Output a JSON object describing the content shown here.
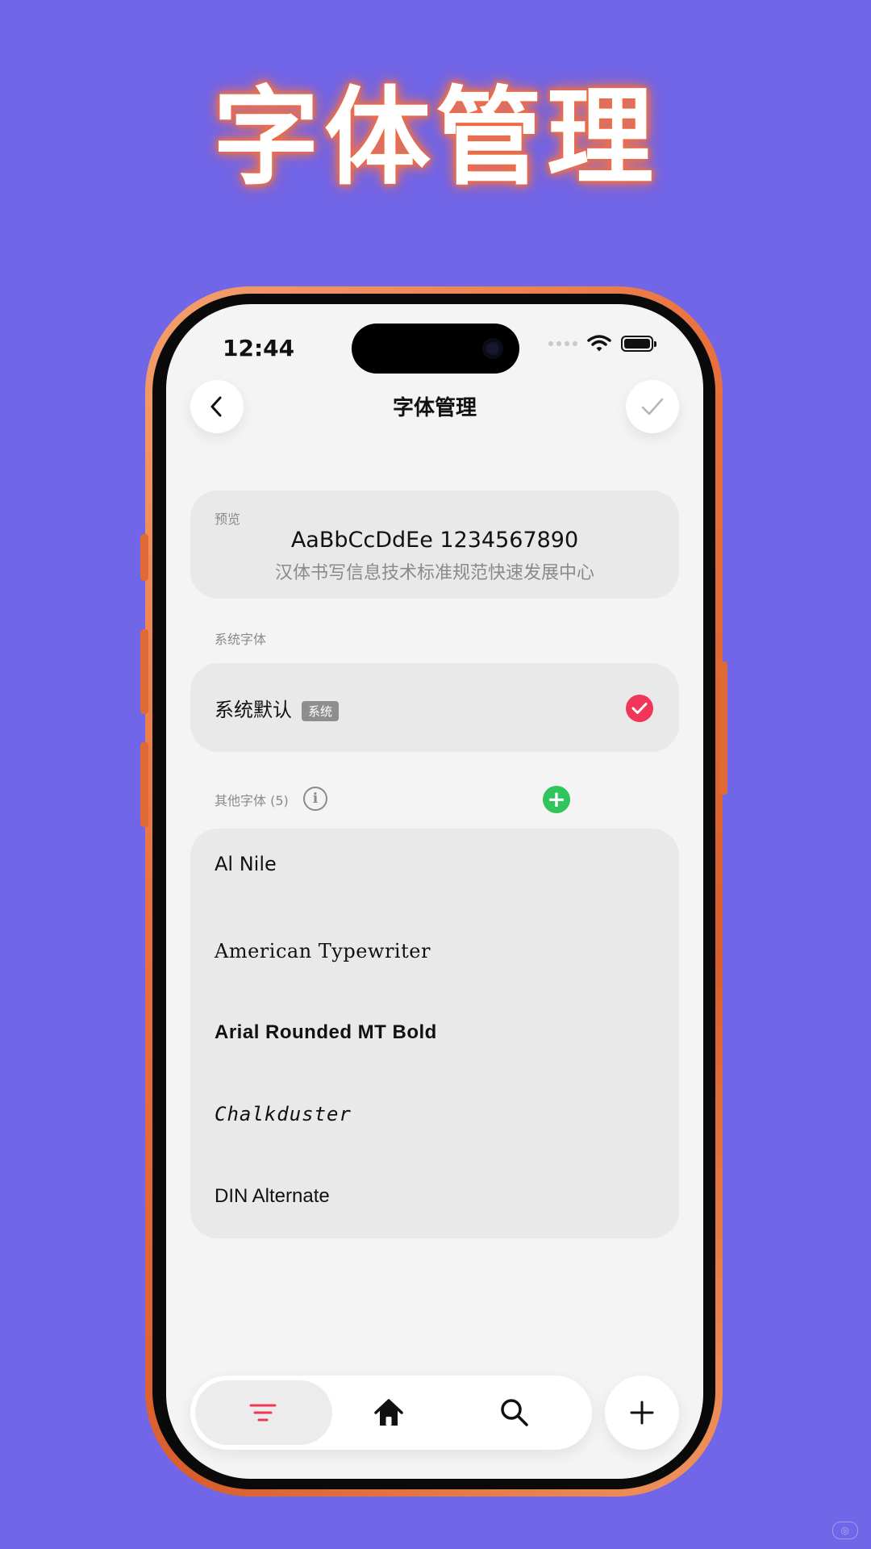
{
  "promo": {
    "title": "字体管理"
  },
  "status_bar": {
    "time": "12:44"
  },
  "nav": {
    "title": "字体管理"
  },
  "preview": {
    "label": "预览",
    "latin_sample": "AaBbCcDdEe 1234567890",
    "cjk_sample": "汉体书写信息技术标准规范快速发展中心"
  },
  "system_fonts": {
    "section_label": "系统字体",
    "items": [
      {
        "name": "系统默认",
        "badge": "系统",
        "selected": true
      }
    ]
  },
  "other_fonts": {
    "section_label": "其他字体 (5)",
    "items": [
      {
        "name": "Al Nile"
      },
      {
        "name": "American Typewriter"
      },
      {
        "name": "Arial Rounded MT Bold"
      },
      {
        "name": "Chalkduster"
      },
      {
        "name": "DIN Alternate"
      }
    ]
  },
  "tab_bar": {
    "tabs": [
      {
        "icon": "list-icon",
        "active": true
      },
      {
        "icon": "home-icon",
        "active": false
      },
      {
        "icon": "search-icon",
        "active": false
      }
    ],
    "fab_icon": "plus-icon"
  },
  "colors": {
    "background": "#7165e8",
    "accent_red": "#f0375a",
    "accent_green": "#2fc45c",
    "frame_orange": "#e8713e"
  }
}
